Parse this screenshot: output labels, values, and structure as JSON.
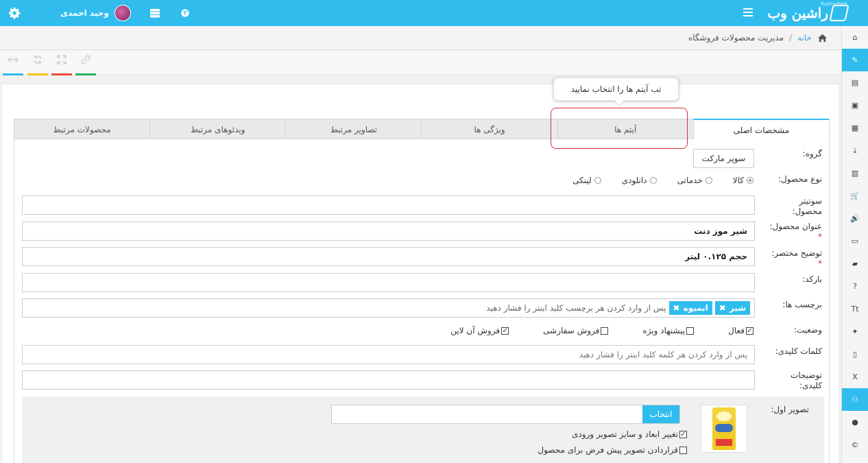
{
  "header": {
    "logo_text": "راشین وب",
    "logo_sub": "RashinWeb",
    "user_name": "وحید احمدی",
    "icons": [
      "gear-icon",
      "globe-icon",
      "server-icon",
      "menu-icon"
    ],
    "bg_color": "#30bdee"
  },
  "breadcrumb": {
    "home": "خانه",
    "separator": "/",
    "current": "مدیریت محصولات فروشگاه"
  },
  "toolbar": {
    "tools": [
      {
        "icon": "link-icon",
        "color": "#27ae60"
      },
      {
        "icon": "expand-icon",
        "color": "#e74c3c"
      },
      {
        "icon": "refresh-icon",
        "color": "#f1c40f"
      },
      {
        "icon": "resize-icon",
        "color": "#30bdee"
      }
    ]
  },
  "tooltip": "تب آیتم ها را انتخاب نمایید",
  "tabs": [
    "مشخصات اصلی",
    "آیتم ها",
    "ویژگی ها",
    "تصاویر مرتبط",
    "ویدئوهای مرتبط",
    "محصولات مرتبط"
  ],
  "form": {
    "group_label": "گروه:",
    "group_value": "سوپر مارکت",
    "type_label": "نوع محصول:",
    "type_options": [
      "کالا",
      "خدماتی",
      "دانلودی",
      "لینکی"
    ],
    "subtitle_label": "سوتیتر محصول:",
    "subtitle_value": "",
    "title_label": "عنوان محصول:",
    "title_value": "شیر موز دنت",
    "desc_label": "توضیح مختصر:",
    "desc_value": "حجم ۰.۱۲۵ لیتر",
    "barcode_label": "بارکد:",
    "tags_label": "برچسب ها:",
    "tags": [
      "شیر",
      "ابمیوه"
    ],
    "tags_placeholder": "پس از وارد کردن هر برچسب کلید اینتر را فشار دهید",
    "status_label": "وضعیت:",
    "status_options": [
      {
        "label": "فعال",
        "checked": true
      },
      {
        "label": "پیشنهاد ویژه",
        "checked": false
      },
      {
        "label": "فروش سفارشی",
        "checked": false
      },
      {
        "label": "فروش آن لاین",
        "checked": true
      }
    ],
    "keywords_label": "کلمات کلیدی:",
    "keywords_placeholder": "پس از وارد کردن هر کلمه کلید اینتر را فشار دهید",
    "keydesc_label": "توضیحات کلیدی:",
    "image_label": "تصویر اول:",
    "select_button": "انتخاب",
    "resize_option": "تغییر ابعاد و سایز تصویر ورودی",
    "default_option": "قراردادن تصویر پیش فرض برای محصول"
  },
  "sidebar": {
    "icons": [
      "home-icon",
      "pencil-icon",
      "newspaper-icon",
      "image-icon",
      "file-icon",
      "download-icon",
      "film-icon",
      "cart-icon",
      "volume-icon",
      "monitor-icon",
      "book-icon",
      "question-icon",
      "text-size-icon",
      "pin-icon",
      "file-blank-icon",
      "excel-icon",
      "users-icon",
      "user-icon",
      "copyright-icon",
      "user-plus-icon"
    ],
    "active_index": 1
  }
}
